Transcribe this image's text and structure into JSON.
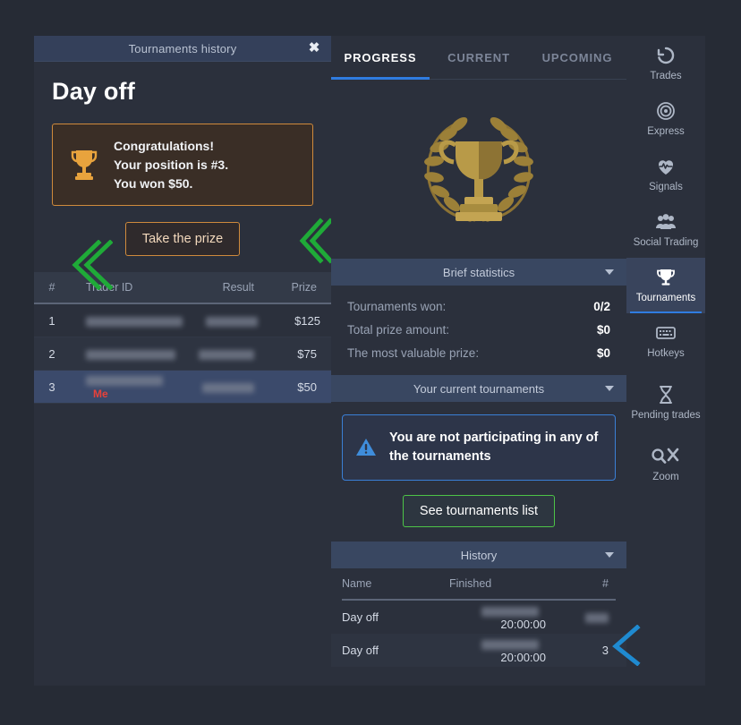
{
  "colors": {
    "app_bg": "#262b35",
    "panel_bg": "#2b303c",
    "titlebar_bg": "#34405a",
    "accent_blue": "#2f7ce0",
    "accent_orange": "#cf8a3c",
    "accent_green": "#4dc447",
    "highlight_row": "#3b4a6b",
    "me_red": "#e8413a",
    "marker_green": "#1faa38",
    "marker_blue": "#1f8ad0"
  },
  "left_panel": {
    "titlebar": {
      "title": "Tournaments history",
      "close_icon": "close-icon"
    },
    "heading": "Day off",
    "congrats": {
      "icon": "trophy-icon",
      "lines": [
        "Congratulations!",
        "Your position is #3.",
        "You won $50."
      ]
    },
    "take_prize_label": "Take the prize",
    "table": {
      "columns": [
        "#",
        "Trader ID",
        "Result",
        "Prize"
      ],
      "rows": [
        {
          "num": "1",
          "trader": "",
          "trader_redacted": true,
          "result": "",
          "result_redacted": true,
          "prize": "$125",
          "me": false
        },
        {
          "num": "2",
          "trader": "",
          "trader_redacted": true,
          "result": "",
          "result_redacted": true,
          "prize": "$75",
          "me": false
        },
        {
          "num": "3",
          "trader": "",
          "trader_redacted": true,
          "result": "",
          "result_redacted": true,
          "prize": "$50",
          "me": true,
          "me_label": "Me"
        }
      ]
    }
  },
  "right_panel": {
    "tabs": [
      {
        "label": "PROGRESS",
        "active": true
      },
      {
        "label": "CURRENT",
        "active": false
      },
      {
        "label": "UPCOMING",
        "active": false
      }
    ],
    "trophy_icon": "trophy-laurel-icon",
    "brief_statistics": {
      "header": "Brief statistics",
      "caret_icon": "chevron-down-icon",
      "rows": [
        {
          "label": "Tournaments won:",
          "value": "0/2"
        },
        {
          "label": "Total prize amount:",
          "value": "$0"
        },
        {
          "label": "The most valuable prize:",
          "value": "$0"
        }
      ]
    },
    "current_tournaments": {
      "header": "Your current tournaments",
      "caret_icon": "chevron-down-icon",
      "notice_icon": "warning-triangle-icon",
      "notice_text": "You are not participating in any of the tournaments",
      "button_label": "See tournaments list"
    },
    "history": {
      "header": "History",
      "caret_icon": "chevron-down-icon",
      "columns": [
        "Name",
        "Finished",
        "#"
      ],
      "rows": [
        {
          "name": "Day off",
          "finished_date_redacted": true,
          "finished_time": "20:00:00",
          "num": "",
          "num_redacted": true
        },
        {
          "name": "Day off",
          "finished_date_redacted": true,
          "finished_time": "20:00:00",
          "num": "3",
          "num_redacted": false
        }
      ]
    }
  },
  "rail": {
    "items": [
      {
        "label": "Trades",
        "icon": "history-clock-icon",
        "active": false
      },
      {
        "label": "Express",
        "icon": "target-icon",
        "active": false
      },
      {
        "label": "Signals",
        "icon": "heart-pulse-icon",
        "active": false
      },
      {
        "label": "Social Trading",
        "icon": "people-group-icon",
        "active": false
      },
      {
        "label": "Tournaments",
        "icon": "trophy-icon",
        "active": true
      },
      {
        "label": "Hotkeys",
        "icon": "keyboard-icon",
        "active": false
      },
      {
        "label": "Pending trades",
        "icon": "hourglass-icon",
        "active": false
      },
      {
        "label": "Zoom",
        "icon": "magnifier-expand-icon",
        "active": false
      }
    ]
  },
  "markers": {
    "green_left_chevron": "double-chevron-left-marker",
    "green_rail_chevron": "double-chevron-left-marker",
    "blue_chevron": "chevron-left-marker"
  }
}
